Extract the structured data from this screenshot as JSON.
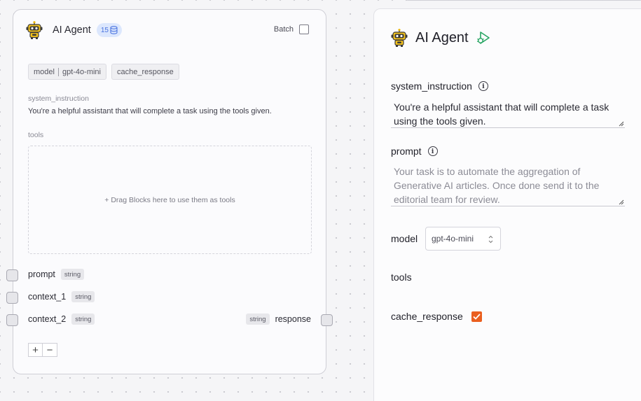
{
  "node": {
    "title": "AI Agent",
    "count_badge": "15",
    "batch_label": "Batch",
    "batch_checked": false,
    "chips": {
      "model_key": "model",
      "model_value": "gpt-4o-mini",
      "cache": "cache_response"
    },
    "system_instruction_label": "system_instruction",
    "system_instruction_value": "You're a helpful assistant that will complete a task using the tools given.",
    "tools_label": "tools",
    "tools_drop_hint": "+ Drag Blocks here to use them as tools",
    "inputs": [
      {
        "label": "prompt",
        "type": "string"
      },
      {
        "label": "context_1",
        "type": "string"
      },
      {
        "label": "context_2",
        "type": "string"
      }
    ],
    "output": {
      "label": "response",
      "type": "string"
    },
    "add_label": "+",
    "remove_label": "−"
  },
  "panel": {
    "title": "AI Agent",
    "system_instruction": {
      "label": "system_instruction",
      "value": "You're a helpful assistant that will complete a task using the tools given."
    },
    "prompt": {
      "label": "prompt",
      "placeholder": "Your task is to automate the aggregation of Generative AI articles. Once done send it to the editorial team for review."
    },
    "model": {
      "label": "model",
      "value": "gpt-4o-mini"
    },
    "tools_label": "tools",
    "cache_response": {
      "label": "cache_response",
      "checked": true
    }
  },
  "icons": {
    "node": "robot-icon",
    "count": "database-icon",
    "run": "run-icon",
    "info": "info-icon"
  },
  "colors": {
    "accent_orange": "#ea5f1f",
    "badge_blue": "#4b74e0",
    "run_green": "#27a563"
  }
}
